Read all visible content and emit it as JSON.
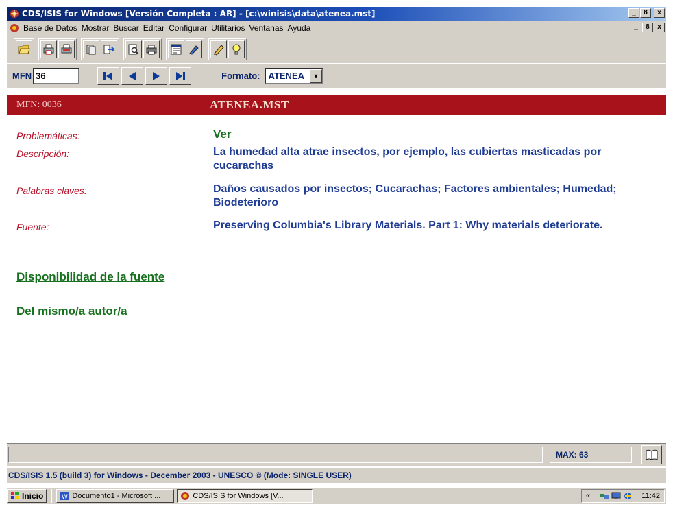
{
  "window": {
    "title": "CDS/ISIS for Windows [Versión Completa : AR] - [c:\\winisis\\data\\atenea.mst]",
    "controls": [
      "_",
      "8",
      "x"
    ]
  },
  "menu": {
    "items": [
      "Base de Datos",
      "Mostrar",
      "Buscar",
      "Editar",
      "Configurar",
      "Utilitarios",
      "Ventanas",
      "Ayuda"
    ]
  },
  "toolbar": {
    "icons": [
      "open-folder-icon",
      "print-icon",
      "print-preview-icon",
      "copy-icon",
      "export-icon",
      "find-icon",
      "printer-icon",
      "form-icon",
      "edit-pen-icon",
      "pencil-icon",
      "lightbulb-icon"
    ]
  },
  "nav": {
    "mfn_label": "MFN",
    "mfn_value": "36",
    "format_label": "Formato:",
    "format_value": "ATENEA"
  },
  "record": {
    "mfn": "MFN: 0036",
    "database": "ATENEA.MST",
    "fields": [
      {
        "label": "Problemáticas:",
        "value": "Ver"
      },
      {
        "label": "Descripción:",
        "value": "La humedad alta atrae insectos, por ejemplo, las cubiertas masticadas por cucarachas"
      },
      {
        "label": "Palabras claves:",
        "value": "Daños causados por insectos; Cucarachas; Factores ambientales; Humedad; Biodeterioro"
      },
      {
        "label": "Fuente:",
        "value": "Preserving Columbia's Library Materials. Part 1: Why materials deteriorate."
      }
    ],
    "link_availability": "Disponibilidad de la fuente",
    "link_same_author": "Del mismo/a autor/a"
  },
  "status": {
    "max": "MAX: 63",
    "version": "CDS/ISIS 1.5 (build 3) for Windows - December 2003 - UNESCO © (Mode: SINGLE USER)"
  },
  "taskbar": {
    "start": "Inicio",
    "tasks": [
      "Documento1 - Microsoft ...",
      "CDS/ISIS for Windows [V..."
    ],
    "clock": "11:42",
    "tray_chevron": "«"
  },
  "colors": {
    "title_bar": "#0a246a",
    "header_band": "#a8121a",
    "field_label": "#b8122a",
    "field_value": "#1f3c93",
    "link": "#17711e",
    "chrome": "#d4d0c8"
  }
}
